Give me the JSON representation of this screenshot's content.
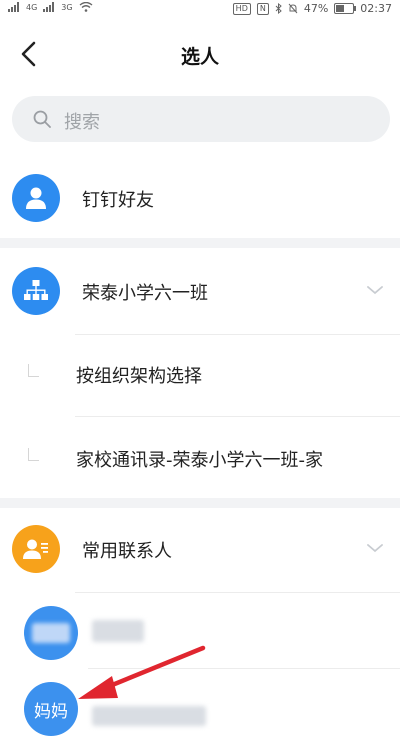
{
  "statusbar": {
    "net1": "4G",
    "net2": "3G",
    "hd": "HD",
    "nfc": "N",
    "battery": "47%",
    "battery_level": 0.47,
    "time": "02:37"
  },
  "header": {
    "title": "选人"
  },
  "search": {
    "placeholder": "搜索"
  },
  "sections": {
    "friends": {
      "label": "钉钉好友"
    },
    "class": {
      "label": "荣泰小学六一班",
      "sub_items": [
        {
          "label": "按组织架构选择"
        },
        {
          "label": "家校通讯录-荣泰小学六一班-家"
        }
      ]
    },
    "frequent": {
      "label": "常用联系人",
      "contacts": [
        {
          "avatar_text": ""
        },
        {
          "avatar_text": "妈妈"
        }
      ]
    }
  },
  "colors": {
    "accent": "#2d8cf0",
    "orange": "#f7a21b",
    "arrow": "#e0262f",
    "separator": "#f2f3f5"
  },
  "icons": {
    "back": "chevron-left-icon",
    "search": "search-icon",
    "friends": "user-icon",
    "class": "org-chart-icon",
    "frequent": "contact-card-icon",
    "collapse": "chevron-down-icon",
    "annotation": "red-arrow"
  }
}
